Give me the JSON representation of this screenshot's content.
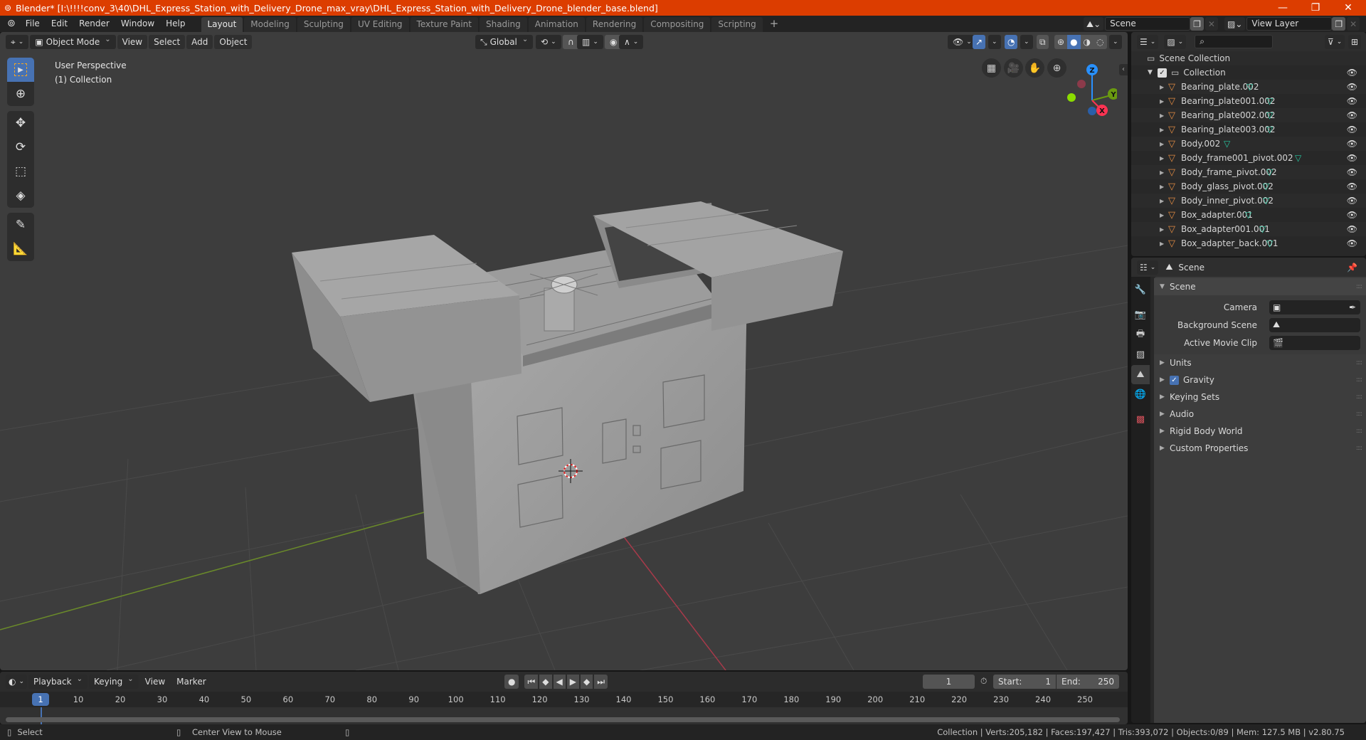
{
  "window": {
    "title": "Blender* [I:\\!!!!conv_3\\40\\DHL_Express_Station_with_Delivery_Drone_max_vray\\DHL_Express_Station_with_Delivery_Drone_blender_base.blend]",
    "controls": {
      "minimize": "—",
      "maximize": "❐",
      "close": "✕"
    }
  },
  "menu": {
    "items": [
      "File",
      "Edit",
      "Render",
      "Window",
      "Help"
    ],
    "workspaces": [
      "Layout",
      "Modeling",
      "Sculpting",
      "UV Editing",
      "Texture Paint",
      "Shading",
      "Animation",
      "Rendering",
      "Compositing",
      "Scripting"
    ],
    "active_workspace": "Layout",
    "add_workspace": "+",
    "scene": "Scene",
    "view_layer": "View Layer"
  },
  "viewport": {
    "mode": "Object Mode",
    "menus": [
      "View",
      "Select",
      "Add",
      "Object"
    ],
    "transform_orientation": "Global",
    "overlay_text_1": "User Perspective",
    "overlay_text_2": "(1) Collection",
    "shading_modes": [
      "wireframe",
      "solid",
      "material",
      "rendered"
    ],
    "active_shading": "solid",
    "gizmo_axes": {
      "x": "X",
      "y": "Y",
      "z": "Z"
    },
    "colors": {
      "x_axis": "#ff3352",
      "y_axis": "#8bdc00",
      "z_axis": "#2890ff",
      "grid_x_line": "#a83a4a",
      "grid_y_line": "#6a8a2a",
      "background": "#3d3d3d"
    },
    "tools": [
      "select-box",
      "cursor",
      "move",
      "rotate",
      "scale",
      "transform",
      "annotate",
      "measure"
    ],
    "active_tool": "select-box"
  },
  "outliner": {
    "root": "Scene Collection",
    "collection": "Collection",
    "items": [
      "Bearing_plate.002",
      "Bearing_plate001.002",
      "Bearing_plate002.002",
      "Bearing_plate003.002",
      "Body.002",
      "Body_frame001_pivot.002",
      "Body_frame_pivot.002",
      "Body_glass_pivot.002",
      "Body_inner_pivot.002",
      "Box_adapter.001",
      "Box_adapter001.001",
      "Box_adapter_back.001"
    ]
  },
  "properties": {
    "context": "Scene",
    "section_scene": "Scene",
    "camera_label": "Camera",
    "background_scene_label": "Background Scene",
    "active_movie_clip_label": "Active Movie Clip",
    "sections": [
      "Units",
      "Gravity",
      "Keying Sets",
      "Audio",
      "Rigid Body World",
      "Custom Properties"
    ],
    "gravity_checked": true
  },
  "timeline": {
    "menus": [
      "Playback",
      "Keying",
      "View",
      "Marker"
    ],
    "current_frame": "1",
    "start_label": "Start:",
    "start": "1",
    "end_label": "End:",
    "end": "250",
    "ticks": [
      "10",
      "20",
      "30",
      "40",
      "50",
      "60",
      "70",
      "80",
      "90",
      "100",
      "110",
      "120",
      "130",
      "140",
      "150",
      "160",
      "170",
      "180",
      "190",
      "200",
      "210",
      "220",
      "230",
      "240",
      "250"
    ]
  },
  "status": {
    "left_hint": "Select",
    "middle_hint": "Center View to Mouse",
    "stats": "Collection | Verts:205,182 | Faces:197,427 | Tris:393,072 | Objects:0/89 | Mem: 127.5 MB | v2.80.75"
  }
}
